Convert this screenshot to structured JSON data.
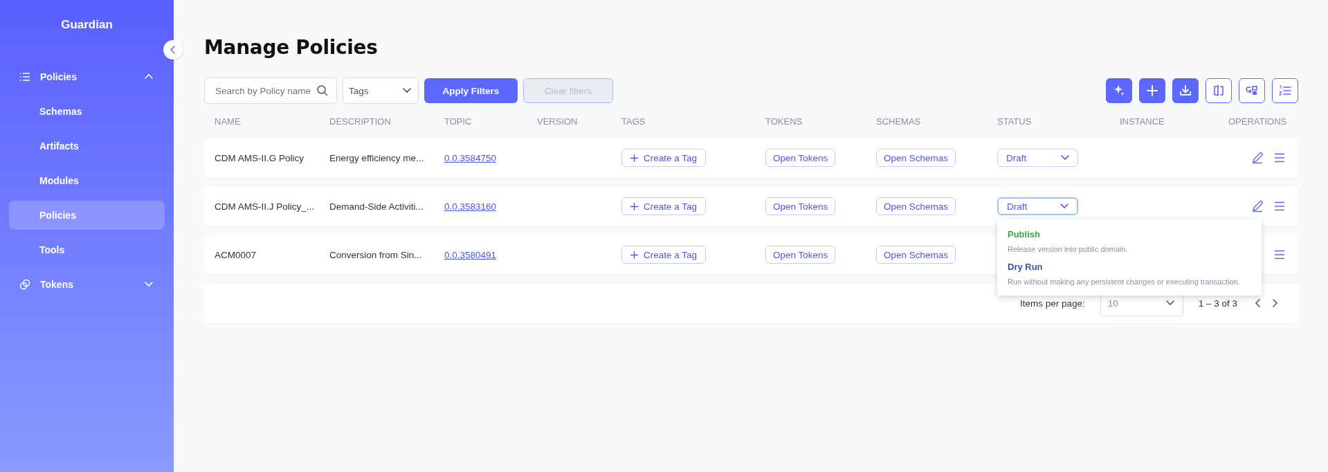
{
  "sidebar": {
    "brand": "Guardian",
    "items": [
      {
        "label": "Policies",
        "kind": "group",
        "expanded": true,
        "selected": false,
        "children": [
          {
            "label": "Schemas",
            "selected": false
          },
          {
            "label": "Artifacts",
            "selected": false
          },
          {
            "label": "Modules",
            "selected": false
          },
          {
            "label": "Policies",
            "selected": true
          },
          {
            "label": "Tools",
            "selected": false
          }
        ]
      },
      {
        "label": "Tokens",
        "kind": "group",
        "expanded": false,
        "selected": false
      }
    ]
  },
  "page": {
    "title": "Manage Policies"
  },
  "filters": {
    "search_placeholder": "Search by Policy name",
    "tags_placeholder": "Tags",
    "apply": "Apply Filters",
    "clear": {
      "label": "Clear filters",
      "disabled": true
    }
  },
  "toolbar": [
    {
      "filled": true
    },
    {
      "filled": true
    },
    {
      "filled": true
    },
    {
      "filled": false
    },
    {
      "filled": false
    },
    {
      "filled": false
    }
  ],
  "table": {
    "columns": [
      "NAME",
      "DESCRIPTION",
      "TOPIC",
      "VERSION",
      "TAGS",
      "TOKENS",
      "SCHEMAS",
      "STATUS",
      "INSTANCE",
      "OPERATIONS"
    ],
    "rows": [
      {
        "name": "CDM AMS-II.G Policy",
        "description": "Energy efficiency me...",
        "topic": "0.0.3584750",
        "tag_button": "Create a Tag",
        "tokens_button": "Open Tokens",
        "schemas_button": "Open Schemas",
        "status": {
          "value": "Draft",
          "open": false
        },
        "operations": [
          {
            "kind": "edit"
          },
          {
            "kind": "menu"
          }
        ]
      },
      {
        "name": "CDM AMS-II.J Policy_...",
        "description": "Demand-Side Activiti...",
        "topic": "0.0.3583160",
        "tag_button": "Create a Tag",
        "tokens_button": "Open Tokens",
        "schemas_button": "Open Schemas",
        "status": {
          "value": "Draft",
          "open": true,
          "options": [
            {
              "label": "Publish",
              "description": "Release version into public domain.",
              "color": "#3aa63f"
            },
            {
              "label": "Dry Run",
              "description": "Run without making any persistent changes or executing transaction.",
              "color": "#3f4fa8"
            }
          ]
        },
        "operations": [
          {
            "kind": "edit"
          },
          {
            "kind": "menu"
          }
        ]
      },
      {
        "name": "ACM0007",
        "description": "Conversion from Sin...",
        "topic": "0.0.3580491",
        "tag_button": "Create a Tag",
        "tokens_button": "Open Tokens",
        "schemas_button": "Open Schemas",
        "operations": [
          {
            "kind": "menu"
          }
        ]
      }
    ]
  },
  "pagination": {
    "label": "Items per page:",
    "page_size": "10",
    "range": "1 – 3 of 3"
  }
}
